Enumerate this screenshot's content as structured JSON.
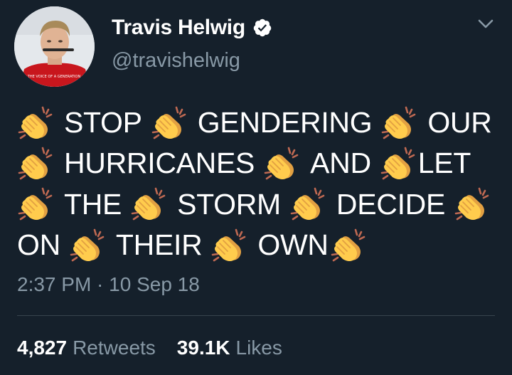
{
  "user": {
    "display_name": "Travis Helwig",
    "handle": "@travishelwig",
    "avatar_caption": "THE VOICE OF A GENERATION"
  },
  "tweet": {
    "lines": [
      [
        "clap",
        "STOP",
        "clap",
        "GENDERING",
        "clap",
        "OUR"
      ],
      [
        "clap",
        "HURRICANES",
        "clap",
        "AND",
        "clap",
        "LET"
      ],
      [
        "clap",
        "THE",
        "clap",
        "STORM",
        "clap",
        "DECIDE",
        "clap"
      ],
      [
        "ON",
        "clap",
        "THEIR",
        "clap",
        "OWN",
        "clap"
      ]
    ],
    "timestamp": "2:37 PM · 10 Sep 18"
  },
  "stats": {
    "retweets_count": "4,827",
    "retweets_label": "Retweets",
    "likes_count": "39.1K",
    "likes_label": "Likes"
  },
  "icons": {
    "verified": "verified-badge-icon",
    "menu": "chevron-down-icon",
    "clap": "clapping-hands-emoji"
  },
  "colors": {
    "background": "#15202b",
    "secondary_text": "#8899a6",
    "divider": "#38444d",
    "clap_yellow": "#ffcc4d"
  }
}
